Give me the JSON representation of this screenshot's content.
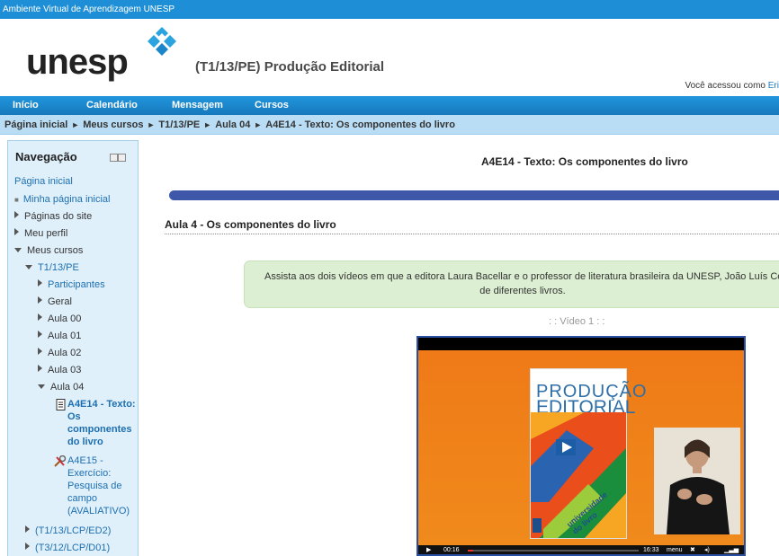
{
  "topbar": {
    "site_name": "Ambiente Virtual de Aprendizagem UNESP"
  },
  "header": {
    "logo_text": "unesp",
    "course_title": "(T1/13/PE) Produção Editorial",
    "logged_prefix": "Você acessou como",
    "logged_user": "Eri"
  },
  "menu": {
    "items": [
      "Início",
      "Calendário",
      "Mensagem",
      "Cursos"
    ]
  },
  "breadcrumb": {
    "items": [
      "Página inicial",
      "Meus cursos",
      "T1/13/PE",
      "Aula 04",
      "A4E14 - Texto: Os componentes do livro"
    ],
    "separator": "►"
  },
  "nav": {
    "title": "Navegação",
    "home": "Página inicial",
    "my_home": "Minha página inicial",
    "site_pages": "Páginas do site",
    "profile": "Meu perfil",
    "my_courses": "Meus cursos",
    "course": "T1/13/PE",
    "participants": "Participantes",
    "general": "Geral",
    "aula00": "Aula 00",
    "aula01": "Aula 01",
    "aula02": "Aula 02",
    "aula03": "Aula 03",
    "aula04": "Aula 04",
    "res1_lines": [
      "A4E14 - Texto:",
      "Os",
      "componentes",
      "do livro"
    ],
    "res2_lines": [
      "A4E15 -",
      "Exercício:",
      "Pesquisa de",
      "campo",
      "(AVALIATIVO)"
    ],
    "course2": "(T1/13/LCP/ED2)",
    "course3": "(T3/12/LCP/D01)"
  },
  "main": {
    "page_title": "A4E14 - Texto: Os componentes do livro",
    "section_title": "Aula 4 - Os componentes do livro",
    "notice_line1": "Assista aos dois vídeos em que a editora Laura Bacellar e o professor de literatura brasileira da UNESP, João Luís Ceccar",
    "notice_line2": "de diferentes livros.",
    "video_label": ": : Vídeo 1 : :"
  },
  "video": {
    "book_title_line1": "PRODUÇÃO",
    "book_title_line2": "EDITORIAL",
    "book_sub1": "universidade",
    "book_sub2": "do livro",
    "time_elapsed": "00:16",
    "time_total": "16:33",
    "menu_label": "menu",
    "colors": {
      "frame": "#2a4fa0",
      "background": "#ef7a17",
      "accent_blue": "#2f6fa8"
    }
  }
}
